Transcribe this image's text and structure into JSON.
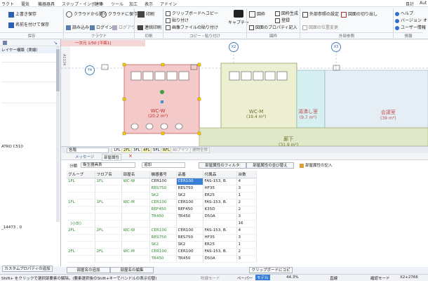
{
  "menu": [
    "ラクト",
    "電気",
    "機器器具",
    "ステップ・インポート",
    "建築",
    "ツール",
    "加工",
    "表示",
    "アドイン"
  ],
  "menu_right": [
    "目計",
    "Aut"
  ],
  "ribbon": {
    "save": "上書き保存",
    "saveas": "名前を付けて保存",
    "cloud_open": "クラウドから開く",
    "cloud_save": "クラウドに保存",
    "read": "読み込み",
    "login": "ログイン",
    "logout": "ログアウト",
    "print": "印刷",
    "batch_print": "連続印刷",
    "clip_copy": "クリップボードへコピー",
    "paste": "貼り付け",
    "img_paste": "画像ファイルの貼り付け",
    "capture": "キャプチャ",
    "drawing": "図枠",
    "drawing_gen": "図枠生成",
    "register": "登録",
    "draw_prop": "図面のプロパティ記入",
    "ext_setting": "外部参照の設定",
    "cut": "図面の切り出し",
    "pos_change": "図面の位置変更",
    "help": "ヘルプ",
    "version": "バージョン",
    "user_info": "ユーザー情報",
    "o": "オ",
    "groups": [
      "保存",
      "クラウド",
      "印刷",
      "コピー・貼り付け",
      "図枠",
      "外部参照",
      "情報"
    ]
  },
  "left": {
    "title": "レイヤー構築（実線）",
    "value1": "ATRO C510",
    "value2": "_14473 , 0",
    "prop_button": "カスタムプロパティの追加"
  },
  "drawing": {
    "title_tab": "一次元 1/50 [平面1]",
    "axes": [
      "X2",
      "X3",
      "Y4",
      "A1134"
    ],
    "rooms": [
      {
        "name": "WC-W",
        "area": "(20.2 m²)"
      },
      {
        "name": "WC-M",
        "area": "(19.4 m²)"
      },
      {
        "name": "湯沸し室",
        "area": "(9.7 m²)"
      },
      {
        "name": "会議室",
        "area": "(39 m²)"
      },
      {
        "name": "廊下",
        "area": "(31.9 m²)"
      }
    ]
  },
  "floor_tabs": {
    "floor_label": "各階",
    "tabs": [
      "1FL",
      "2FL",
      "3FL",
      "4FL",
      "5FL",
      "RFL"
    ],
    "all": "Allアイソ",
    "aux": "建物全体"
  },
  "lower": {
    "tab1": "メッセージ",
    "tab2": "部屋属性",
    "filter_label": "分類",
    "filter_value": "衛生器具表",
    "add_label": "追加",
    "btn_filter": "部屋属性のフィルタ",
    "btn_sort": "部屋属性の並び替え",
    "btn_write": "部屋属性の記入",
    "columns": [
      "グループ",
      "フロア名",
      "部屋名",
      "機器番号",
      "品番",
      "付属品",
      "台数"
    ],
    "rows": [
      [
        "1FL",
        "1FL",
        "WC-W",
        "CER100",
        "CER100",
        "FAS-153, B.",
        "4"
      ],
      [
        "",
        "",
        "",
        "RES750",
        "RES750",
        "HF35",
        "3"
      ],
      [
        "",
        "",
        "",
        "SK2",
        "SK2",
        "ER25",
        "1"
      ],
      [
        "1FL",
        "1FL",
        "WC-M",
        "CER100",
        "CER100",
        "FAS-153, B.",
        "2"
      ],
      [
        "",
        "",
        "",
        "REF450",
        "REF450",
        "K35D",
        "2"
      ],
      [
        "",
        "",
        "",
        "TR450",
        "TR450",
        "D50A",
        "3"
      ],
      [
        "（小計）",
        "",
        "",
        "",
        "",
        "",
        "16"
      ],
      [
        "2FL",
        "2FL",
        "WC-W",
        "CER100",
        "CER100",
        "FAS-153, B.",
        "4"
      ],
      [
        "",
        "",
        "",
        "RES750",
        "RES750",
        "HF35",
        "3"
      ],
      [
        "",
        "",
        "",
        "SK2",
        "SK2",
        "ER25",
        "1"
      ],
      [
        "2FL",
        "2FL",
        "WC-M",
        "CER100",
        "CER100",
        "FAS-153, B.",
        "2"
      ],
      [
        "",
        "",
        "",
        "TR450",
        "TR450",
        "D50A",
        "3"
      ]
    ],
    "btn_add_room": "部屋名の追加",
    "btn_edit_room": "部屋名の編集",
    "btn_clip": "クリップボードにコピー"
  },
  "status": {
    "hint": "Shift+ をクリックで選択部要素の解除。(要素選択後のShift+キーでハンドルの表示切替)",
    "snap": "吹線モード",
    "zoom": "44.3%",
    "paper": "ペーパー",
    "model": "モデル",
    "ortho": "直線",
    "confirm": "確認モード",
    "coord": "X2+2766"
  }
}
